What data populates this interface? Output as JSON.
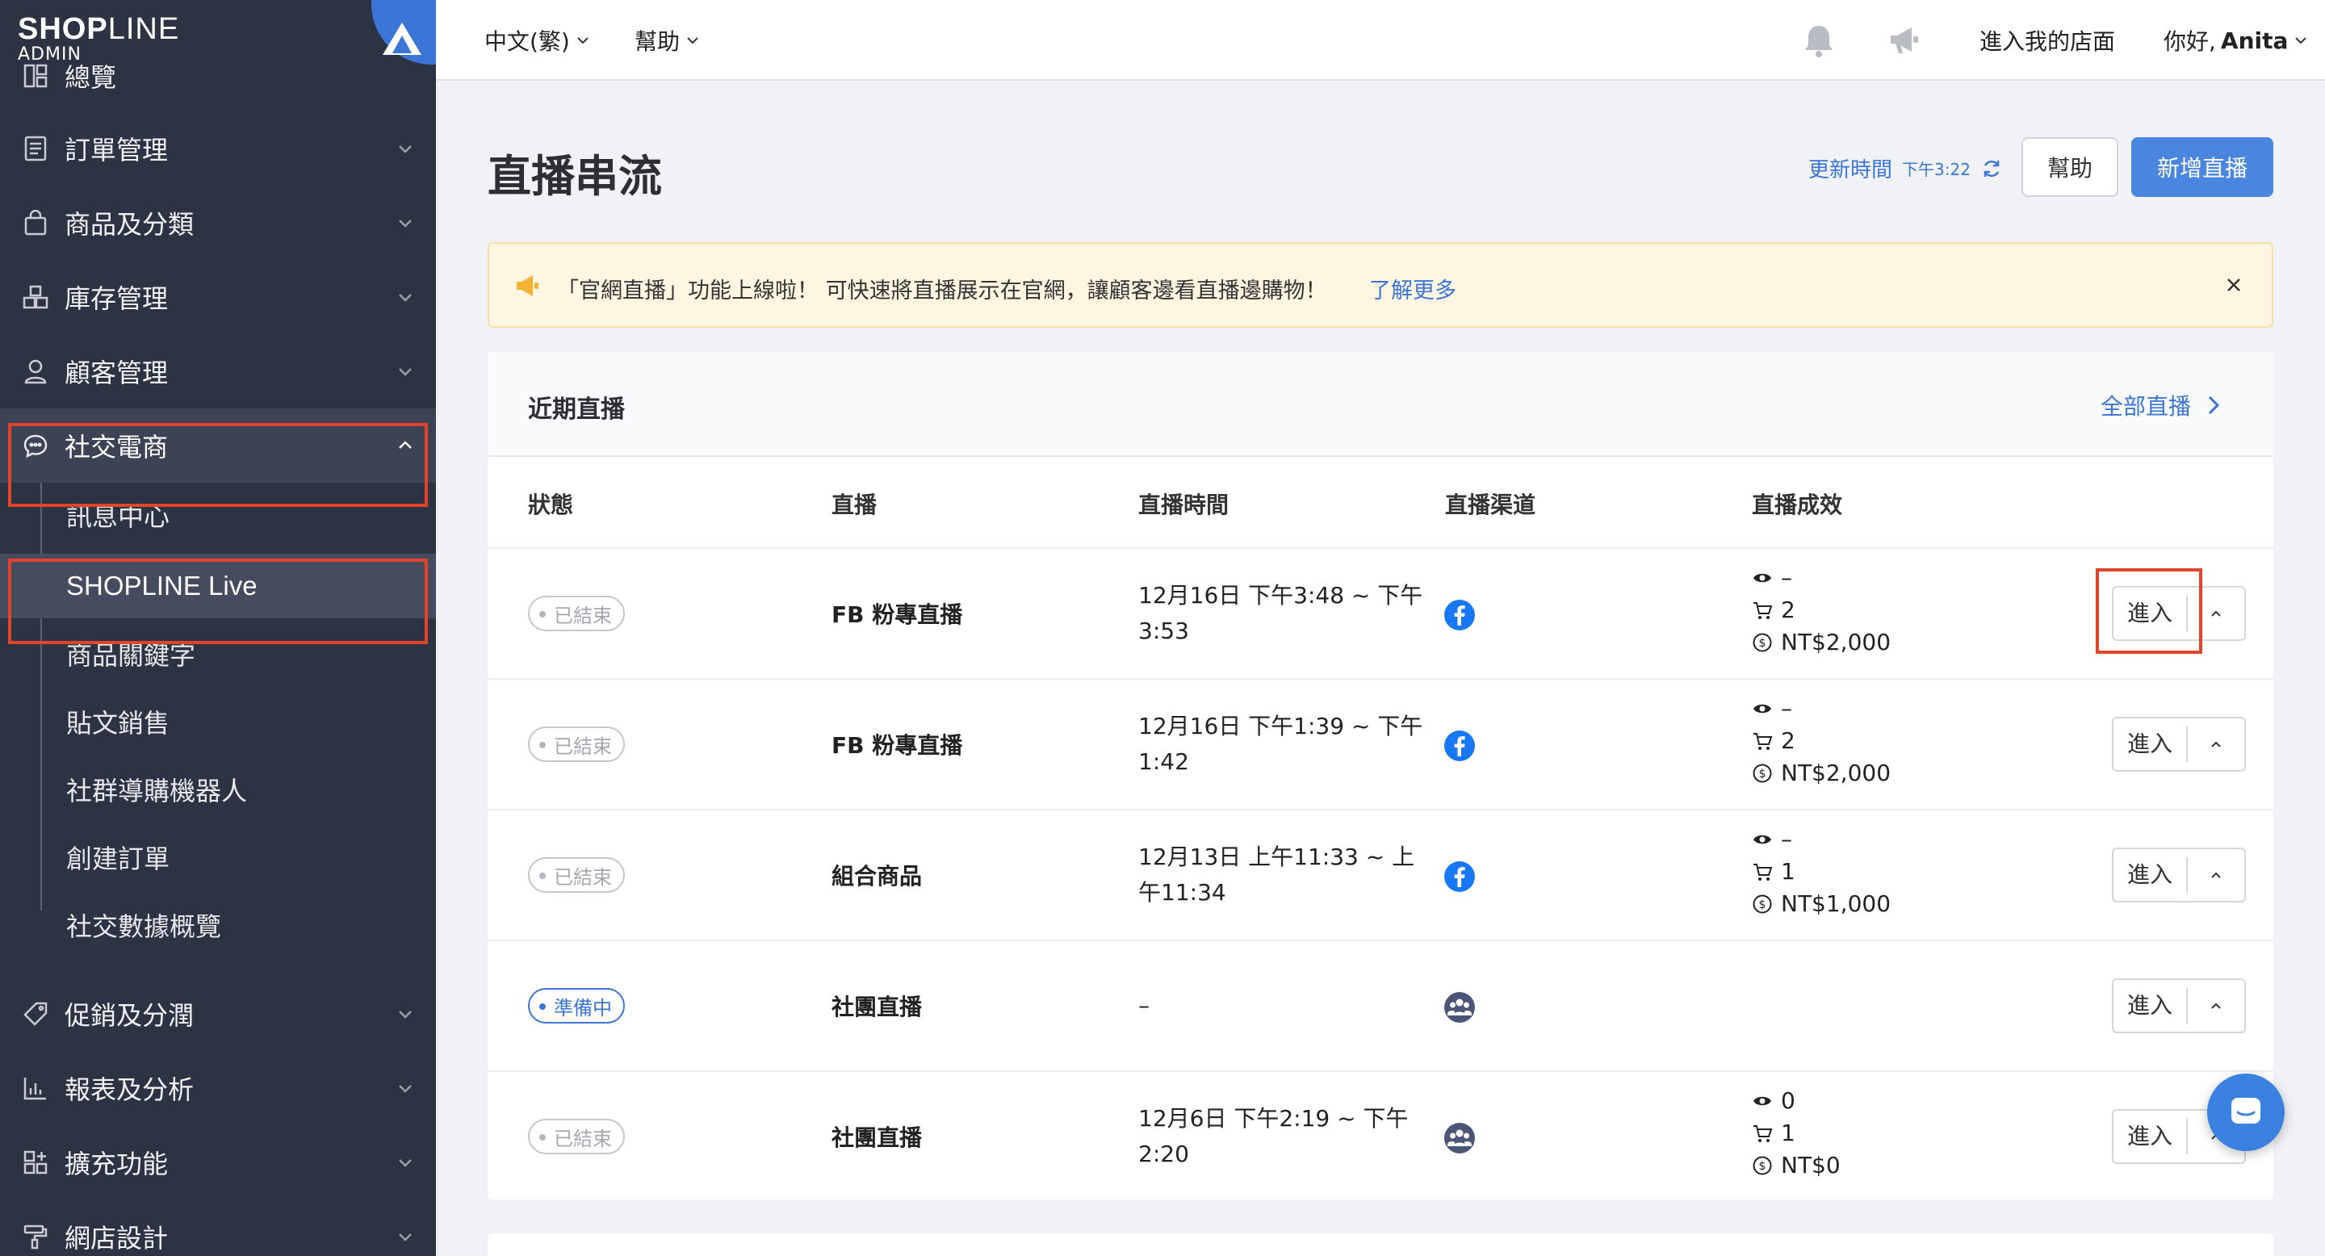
{
  "sidebar": {
    "brand": "SHOPLINE",
    "brand_part1": "SHOP",
    "brand_part2": "LINE",
    "brand_sub": "ADMIN",
    "items": [
      {
        "label": "總覽",
        "icon": "dashboard-icon"
      },
      {
        "label": "訂單管理",
        "icon": "order-icon"
      },
      {
        "label": "商品及分類",
        "icon": "shopping-bag-icon"
      },
      {
        "label": "庫存管理",
        "icon": "inventory-icon"
      },
      {
        "label": "顧客管理",
        "icon": "user-icon"
      },
      {
        "label": "社交電商",
        "icon": "chat-bubble-icon"
      },
      {
        "label": "促銷及分潤",
        "icon": "tag-icon"
      },
      {
        "label": "報表及分析",
        "icon": "chart-icon"
      },
      {
        "label": "擴充功能",
        "icon": "apps-icon"
      },
      {
        "label": "網店設計",
        "icon": "paint-roller-icon"
      }
    ],
    "sub_items": [
      "訊息中心",
      "SHOPLINE Live",
      "商品關鍵字",
      "貼文銷售",
      "社群導購機器人",
      "創建訂單",
      "社交數據概覽"
    ]
  },
  "topbar": {
    "language": "中文(繁)",
    "help": "幫助",
    "enter_store": "進入我的店面",
    "greeting": "你好,",
    "user": "Anita"
  },
  "page": {
    "title": "直播串流",
    "update_label": "更新時間",
    "update_time": "下午3:22",
    "help_button": "幫助",
    "new_button": "新增直播"
  },
  "banner": {
    "message": "「官網直播」功能上線啦！ 可快速將直播展示在官網，讓顧客邊看直播邊購物！",
    "link": "了解更多"
  },
  "recent": {
    "title": "近期直播",
    "all_link": "全部直播",
    "columns": [
      "狀態",
      "直播",
      "直播時間",
      "直播渠道",
      "直播成效"
    ],
    "enter_label": "進入",
    "rows": [
      {
        "status": "已結束",
        "name": "FB 粉專直播",
        "time": "12月16日 下午3:48 ~ 下午3:53",
        "channel": "facebook",
        "views": "–",
        "orders": "2",
        "revenue": "NT$2,000"
      },
      {
        "status": "已結束",
        "name": "FB 粉專直播",
        "time": "12月16日 下午1:39 ~ 下午1:42",
        "channel": "facebook",
        "views": "–",
        "orders": "2",
        "revenue": "NT$2,000"
      },
      {
        "status": "已結束",
        "name": "組合商品",
        "time": "12月13日 上午11:33 ~ 上午11:34",
        "channel": "facebook",
        "views": "–",
        "orders": "1",
        "revenue": "NT$1,000"
      },
      {
        "status": "準備中",
        "name": "社團直播",
        "time": "–",
        "channel": "group",
        "views": "",
        "orders": "",
        "revenue": ""
      },
      {
        "status": "已結束",
        "name": "社團直播",
        "time": "12月6日 下午2:19 ~ 下午2:20",
        "channel": "group",
        "views": "0",
        "orders": "1",
        "revenue": "NT$0"
      }
    ]
  },
  "colors": {
    "sidebar_bg": "#2c3342",
    "accent": "#3b76d6",
    "highlight": "#e0452b",
    "banner_bg": "#fff6e1"
  }
}
